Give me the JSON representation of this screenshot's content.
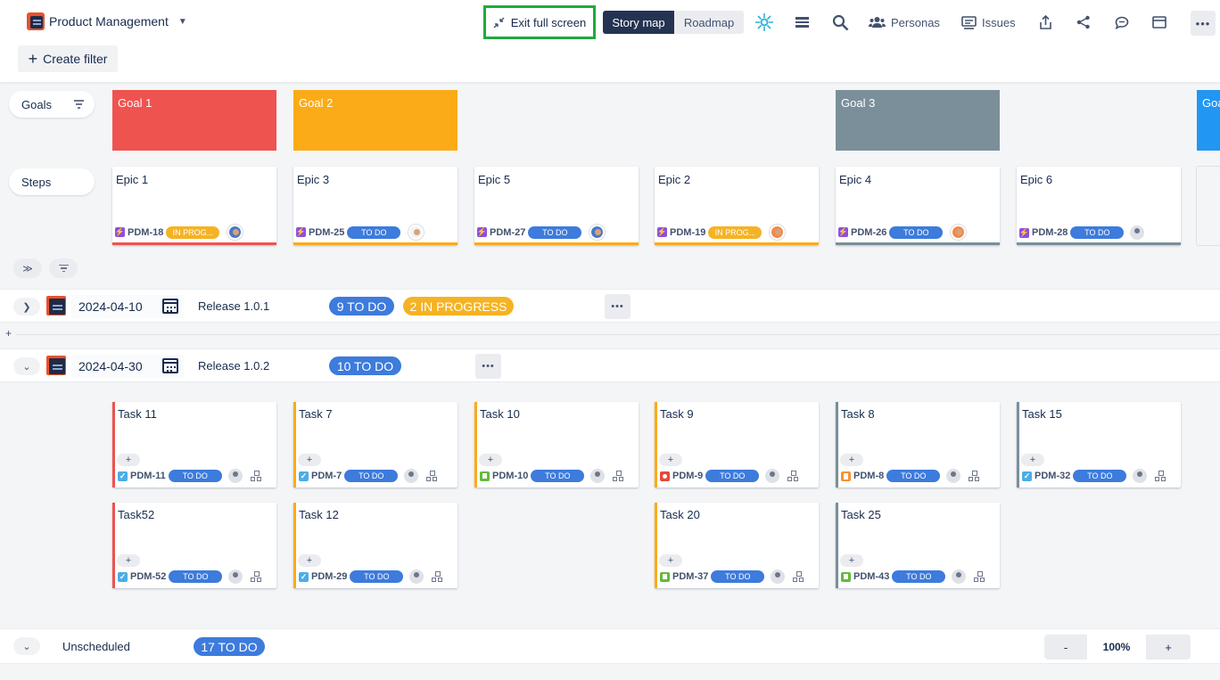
{
  "header": {
    "project_name": "Product Management",
    "create_filter": "Create filter",
    "exit_fullscreen": "Exit full screen",
    "view_story_map": "Story map",
    "view_roadmap": "Roadmap",
    "personas": "Personas",
    "issues": "Issues"
  },
  "rows": {
    "goals_label": "Goals",
    "steps_label": "Steps"
  },
  "goals": [
    {
      "name": "Goal 1",
      "color": "#ef5350"
    },
    {
      "name": "Goal 2",
      "color": "#fbab18"
    },
    {
      "name": "Goal 3",
      "color": "#7b8f9a"
    },
    {
      "name": "Goa",
      "color": "#2196f3"
    }
  ],
  "epics": [
    {
      "title": "Epic 1",
      "key": "PDM-18",
      "status": "IN PROG...",
      "bar": "#ef5350"
    },
    {
      "title": "Epic 3",
      "key": "PDM-25",
      "status": "TO DO",
      "bar": "#fbab18"
    },
    {
      "title": "Epic 5",
      "key": "PDM-27",
      "status": "TO DO",
      "bar": "#fbab18"
    },
    {
      "title": "Epic 2",
      "key": "PDM-19",
      "status": "IN PROG...",
      "bar": "#fbab18"
    },
    {
      "title": "Epic 4",
      "key": "PDM-26",
      "status": "TO DO",
      "bar": "#7b8f9a"
    },
    {
      "title": "Epic 6",
      "key": "PDM-28",
      "status": "TO DO",
      "bar": "#7b8f9a"
    }
  ],
  "releases": [
    {
      "date": "2024-04-10",
      "name": "Release 1.0.1",
      "todo": "9 TO DO",
      "progress": "2 IN PROGRESS"
    },
    {
      "date": "2024-04-30",
      "name": "Release 1.0.2",
      "todo": "10 TO DO"
    }
  ],
  "tasks_row1": [
    {
      "title": "Task 11",
      "key": "PDM-11",
      "status": "TO DO",
      "type": "task",
      "bar": "#ef5350"
    },
    {
      "title": "Task 7",
      "key": "PDM-7",
      "status": "TO DO",
      "type": "task",
      "bar": "#fbab18"
    },
    {
      "title": "Task 10",
      "key": "PDM-10",
      "status": "TO DO",
      "type": "story",
      "bar": "#fbab18"
    },
    {
      "title": "Task 9",
      "key": "PDM-9",
      "status": "TO DO",
      "type": "bug",
      "bar": "#fbab18"
    },
    {
      "title": "Task 8",
      "key": "PDM-8",
      "status": "TO DO",
      "type": "improve",
      "bar": "#7b8f9a"
    },
    {
      "title": "Task 15",
      "key": "PDM-32",
      "status": "TO DO",
      "type": "task",
      "bar": "#7b8f9a"
    }
  ],
  "tasks_row2": [
    {
      "title": "Task52",
      "key": "PDM-52",
      "status": "TO DO",
      "type": "task",
      "bar": "#ef5350"
    },
    {
      "title": "Task 12",
      "key": "PDM-29",
      "status": "TO DO",
      "type": "task",
      "bar": "#fbab18"
    },
    {
      "title": "Task 20",
      "key": "PDM-37",
      "status": "TO DO",
      "type": "story",
      "bar": "#fbab18"
    },
    {
      "title": "Task 25",
      "key": "PDM-43",
      "status": "TO DO",
      "type": "story",
      "bar": "#7b8f9a"
    }
  ],
  "unscheduled": {
    "label": "Unscheduled",
    "todo": "17 TO DO"
  },
  "zoom": {
    "minus": "-",
    "value": "100%",
    "plus": "+"
  }
}
